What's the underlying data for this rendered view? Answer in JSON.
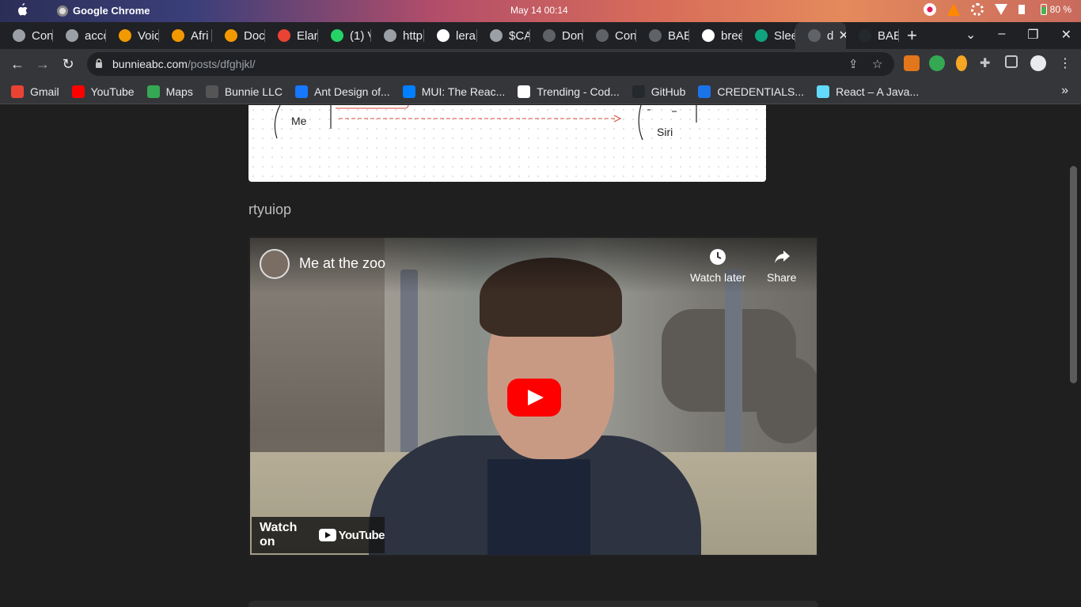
{
  "os_bar": {
    "app_name": "Google Chrome",
    "clock": "May 14  00:14",
    "battery": "80 %"
  },
  "tabs": [
    {
      "label": "Con",
      "icon": "globe-icon"
    },
    {
      "label": "acco",
      "icon": "globe-icon"
    },
    {
      "label": "Voic",
      "icon": "at-icon"
    },
    {
      "label": "Afri",
      "icon": "at-icon"
    },
    {
      "label": "Doc",
      "icon": "at-icon"
    },
    {
      "label": "Elar",
      "icon": "elastic-icon"
    },
    {
      "label": "(1) V",
      "icon": "whatsapp-icon"
    },
    {
      "label": "http",
      "icon": "globe-icon"
    },
    {
      "label": "lera",
      "icon": "google-icon"
    },
    {
      "label": "$CA",
      "icon": "globe-icon"
    },
    {
      "label": "Don",
      "icon": "bunnie-icon"
    },
    {
      "label": "Con",
      "icon": "bunnie-icon"
    },
    {
      "label": "BAE",
      "icon": "bunnie-icon"
    },
    {
      "label": "bree",
      "icon": "google-icon"
    },
    {
      "label": "Slee",
      "icon": "chatgpt-icon"
    },
    {
      "label": "d",
      "icon": "bunnie-icon",
      "active": true
    },
    {
      "label": "BAE",
      "icon": "github-icon"
    }
  ],
  "omnibox": {
    "host": "bunnieabc.com",
    "path": "/posts/dfghjkl/"
  },
  "bookmarks": [
    {
      "label": "Gmail",
      "color": "#ea4335"
    },
    {
      "label": "YouTube",
      "color": "#ff0000"
    },
    {
      "label": "Maps",
      "color": "#34a853"
    },
    {
      "label": "Bunnie LLC",
      "color": "#555555"
    },
    {
      "label": "Ant Design of...",
      "color": "#1677ff"
    },
    {
      "label": "MUI: The Reac...",
      "color": "#007fff"
    },
    {
      "label": "Trending - Cod...",
      "color": "#ffffff"
    },
    {
      "label": "GitHub",
      "color": "#24292e"
    },
    {
      "label": "CREDENTIALS...",
      "color": "#1a73e8"
    },
    {
      "label": "React – A Java...",
      "color": "#61dafb"
    }
  ],
  "whiteboard": {
    "label_me": "Me",
    "label_siri": "Siri"
  },
  "post": {
    "text": "rtyuiop"
  },
  "video": {
    "title": "Me at the zoo",
    "watch_later": "Watch later",
    "share": "Share",
    "watch_on": "Watch on",
    "youtube": "YouTube"
  }
}
